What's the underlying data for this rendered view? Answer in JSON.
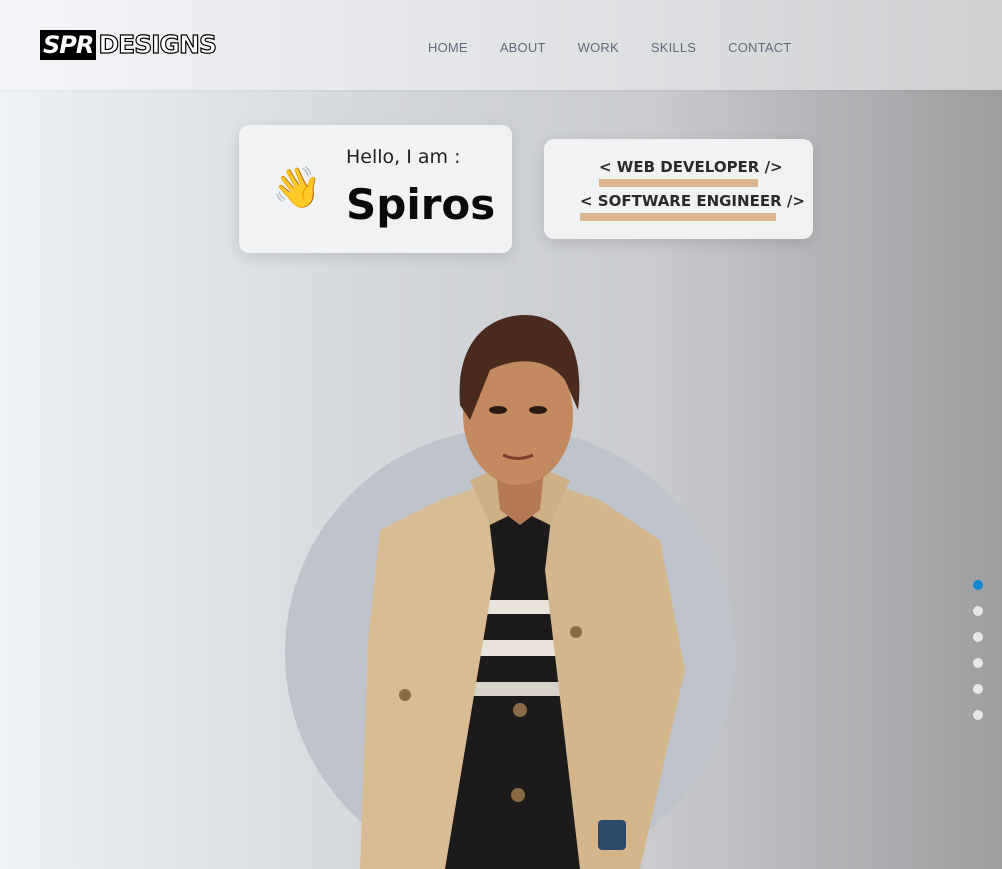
{
  "brand": {
    "mark": "SPR",
    "text": "DESIGNS"
  },
  "nav": [
    "HOME",
    "ABOUT",
    "WORK",
    "SKILLS",
    "CONTACT"
  ],
  "hero": {
    "greeting": "Hello, I am :",
    "name": "Spiros",
    "wave_icon": "👋",
    "roles": [
      "< WEB DEVELOPER />",
      "< SOFTWARE ENGINEER />"
    ]
  },
  "section_dots": {
    "count": 6,
    "active_index": 0
  },
  "colors": {
    "accent": "#1589d6",
    "underline": "#dcb68d",
    "card_bg": "#f1f2f4",
    "circle": "#bfc4cc"
  }
}
